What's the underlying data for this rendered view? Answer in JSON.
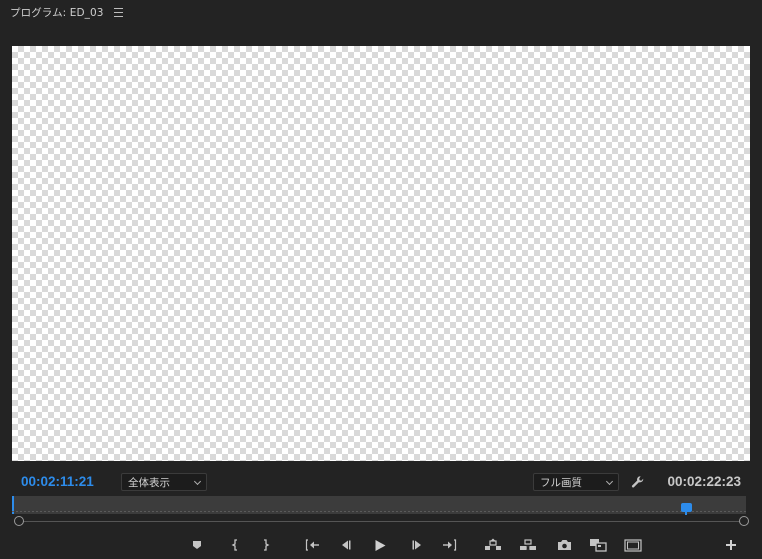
{
  "panel": {
    "title": "プログラム: ED_03",
    "menu_icon": "hamburger-icon"
  },
  "timecode": {
    "current": "00:02:11:21",
    "duration": "00:02:22:23"
  },
  "zoom_select": {
    "value": "全体表示"
  },
  "quality_select": {
    "value": "フル画質"
  },
  "playhead": {
    "position_fraction": 0.919
  },
  "transport": {
    "buttons": [
      "add-marker",
      "mark-in",
      "mark-out",
      "go-to-in",
      "step-back",
      "play",
      "step-forward",
      "go-to-out",
      "lift",
      "extract",
      "export-frame",
      "comparison-view",
      "safe-margins",
      "button-editor"
    ]
  },
  "colors": {
    "accent": "#2d8ceb",
    "background": "#232323",
    "track": "#3c3c3c"
  }
}
